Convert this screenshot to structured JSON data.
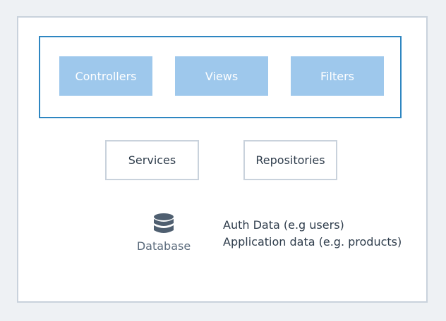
{
  "diagram": {
    "mvc_components": [
      "Controllers",
      "Views",
      "Filters"
    ],
    "layers": [
      "Services",
      "Repositories"
    ],
    "database": {
      "label": "Database",
      "icon": "database-icon"
    },
    "data_notes": [
      "Auth Data (e.g users)",
      "Application data (e.g. products)"
    ]
  },
  "colors": {
    "mvc_group_border": "#2e86c1",
    "mvc_box_fill": "#9ec8ec",
    "layer_border": "#c9d2dc",
    "icon": "#4f5f70"
  }
}
